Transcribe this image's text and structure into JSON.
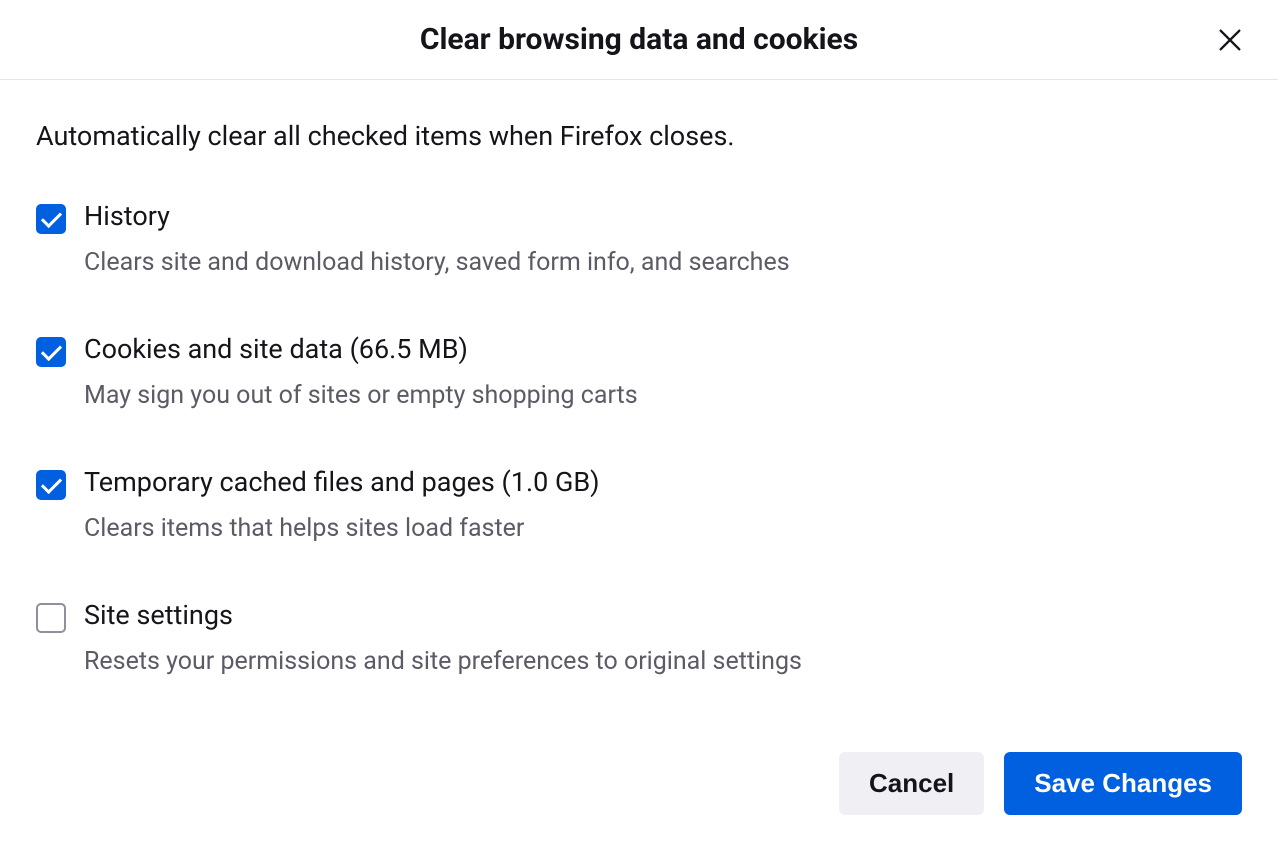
{
  "dialog": {
    "title": "Clear browsing data and cookies",
    "intro": "Automatically clear all checked items when Firefox closes."
  },
  "options": [
    {
      "label": "History",
      "description": "Clears site and download history, saved form info, and searches",
      "checked": true
    },
    {
      "label": "Cookies and site data (66.5 MB)",
      "description": "May sign you out of sites or empty shopping carts",
      "checked": true
    },
    {
      "label": "Temporary cached files and pages (1.0 GB)",
      "description": "Clears items that helps sites load faster",
      "checked": true
    },
    {
      "label": "Site settings",
      "description": "Resets your permissions and site preferences to original settings",
      "checked": false
    }
  ],
  "buttons": {
    "cancel": "Cancel",
    "save": "Save Changes"
  }
}
